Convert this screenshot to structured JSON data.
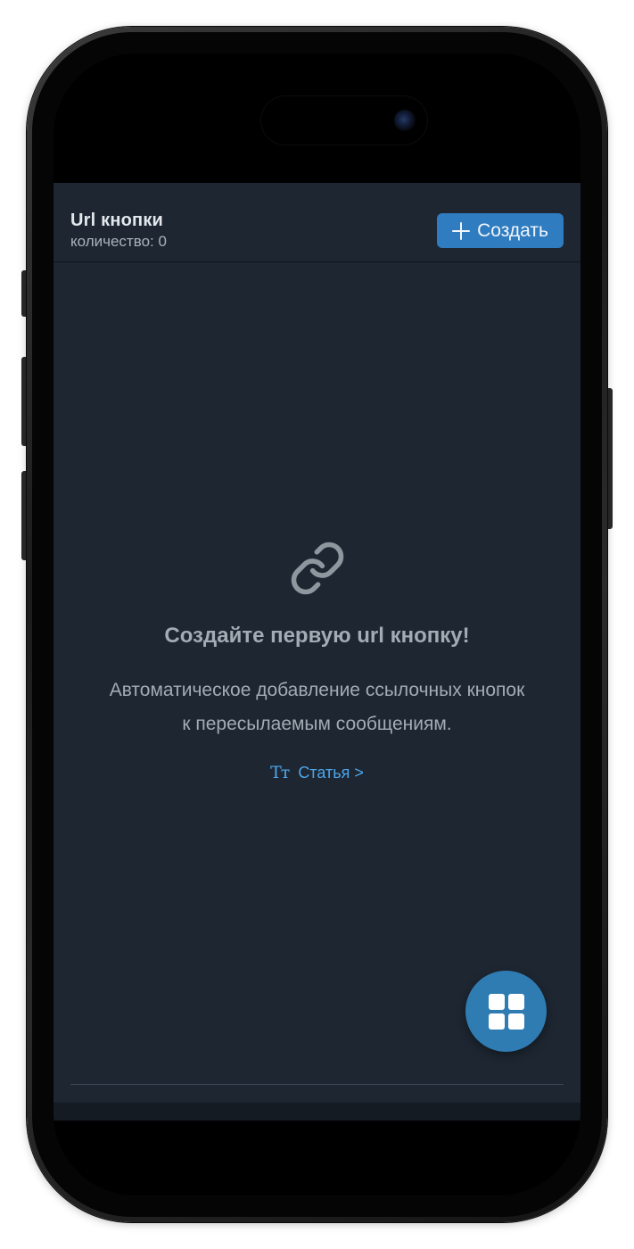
{
  "header": {
    "title": "Url кнопки",
    "subtitle": "количество: 0",
    "create_label": "Создать"
  },
  "empty_state": {
    "title": "Создайте первую url кнопку!",
    "description_line1": "Автоматическое добавление ссылочных кнопок",
    "description_line2": "к пересылаемым сообщениям.",
    "article_icon": "Tт",
    "article_label": "Статья >"
  },
  "icons": {
    "create": "plus-icon",
    "empty": "link-icon",
    "article": "text-format-icon",
    "fab": "grid-icon"
  },
  "colors": {
    "background": "#1d2631",
    "accent": "#2f7cc0",
    "link": "#4da6ec",
    "muted_text": "#a3acb4"
  }
}
